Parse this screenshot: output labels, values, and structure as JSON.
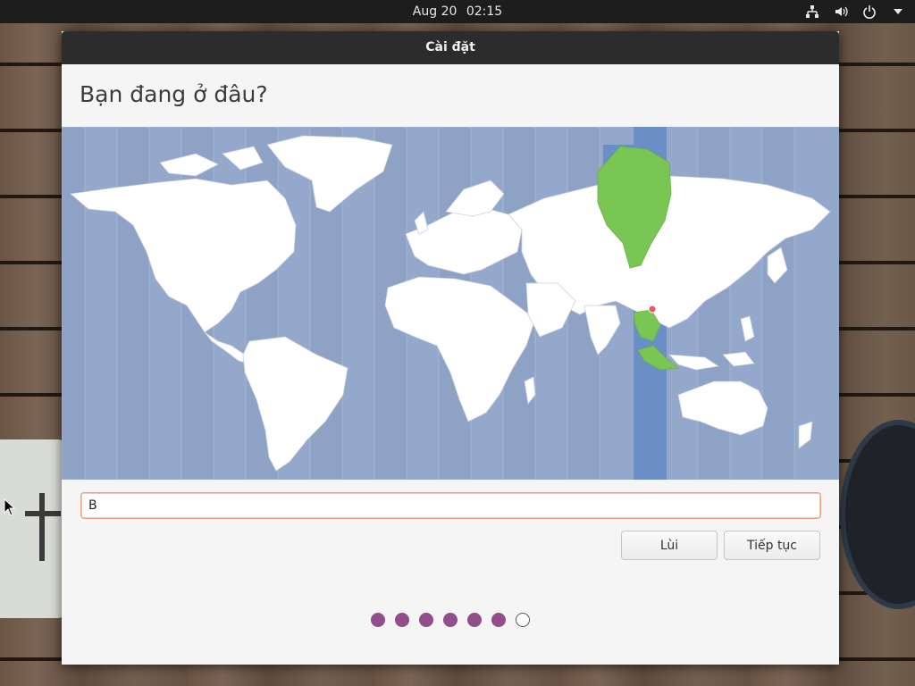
{
  "topbar": {
    "date": "Aug 20",
    "time": "02:15",
    "icons": [
      "network-icon",
      "volume-icon",
      "power-icon",
      "menu-arrow-icon"
    ]
  },
  "window": {
    "title": "Cài đặt",
    "heading": "Bạn đang ở đâu?"
  },
  "location": {
    "input_value": "B",
    "selected_timezone_color": "#6a8fc7",
    "highlight_region_color": "#7ac655",
    "map_water_color": "#94a8cb",
    "pin_color": "#e55a5a"
  },
  "buttons": {
    "back_label": "Lùi",
    "continue_label": "Tiếp tục"
  },
  "progress": {
    "total_steps": 7,
    "completed_steps": 6,
    "accent": "#924d8b"
  }
}
